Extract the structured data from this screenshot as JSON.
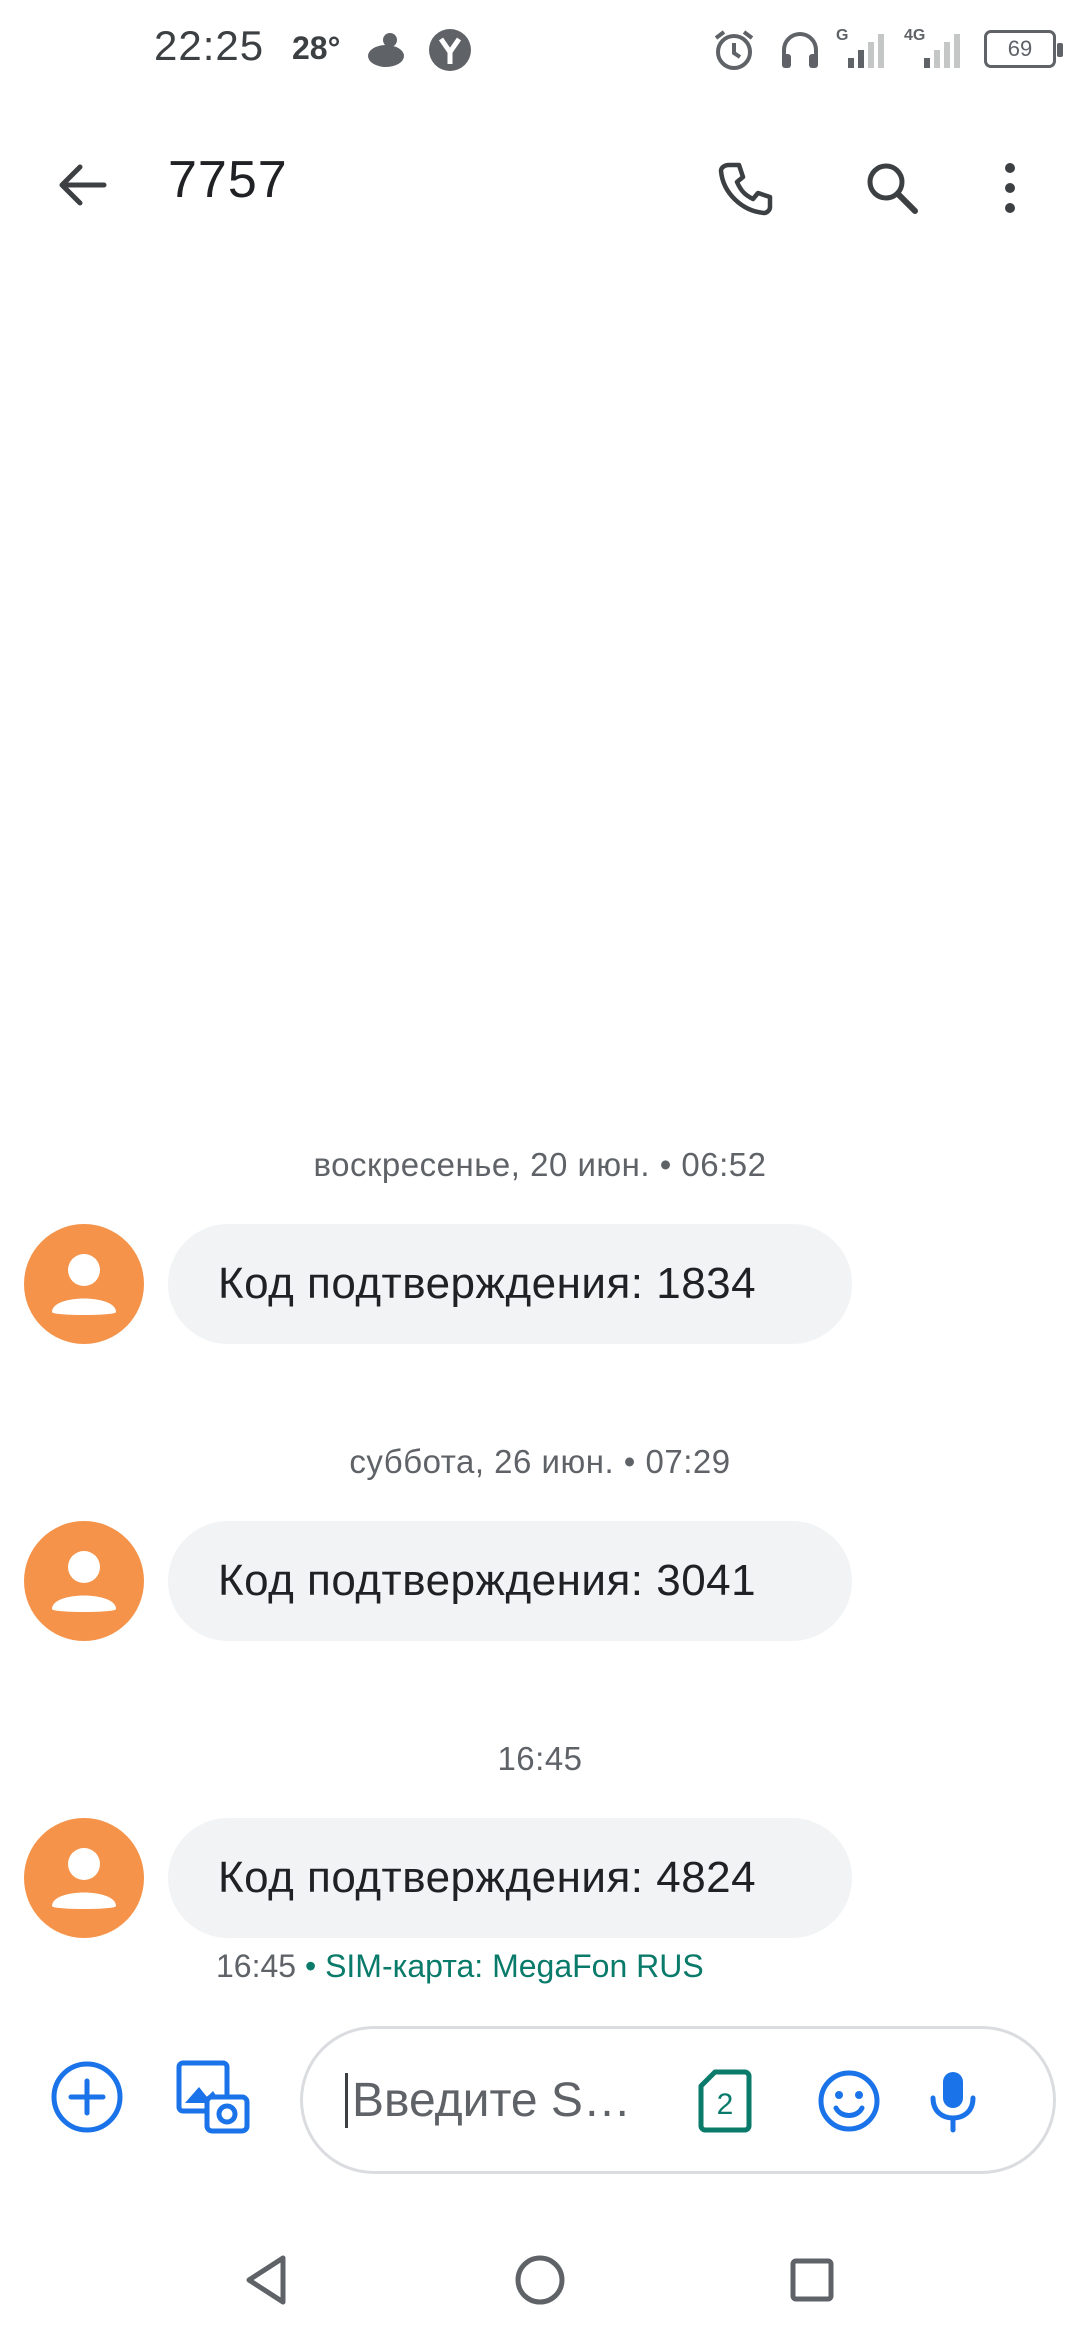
{
  "status_bar": {
    "time": "22:25",
    "temperature": "28°",
    "battery": "69",
    "network_labels": [
      "G",
      "4G"
    ]
  },
  "app_bar": {
    "title": "7757",
    "icons": [
      "back-arrow-icon",
      "phone-icon",
      "search-icon",
      "more-vert-icon"
    ]
  },
  "messages": [
    {
      "date": "воскресенье, 20 июн. • 06:52",
      "text": "Код подтверждения: 1834"
    },
    {
      "date": "суббота, 26 июн. • 07:29",
      "text": "Код подтверждения: 3041"
    },
    {
      "date": "16:45",
      "text": "Код подтверждения: 4824",
      "meta_time": "16:45",
      "meta_sim": " • SIM-карта: MegaFon RUS"
    }
  ],
  "compose": {
    "placeholder": "Введите SMS...",
    "sim_number": "2",
    "icons": [
      "add-circle-icon",
      "gallery-camera-icon",
      "sim-card-icon",
      "emoji-icon",
      "microphone-icon"
    ]
  },
  "colors": {
    "accent": "#1a73e8",
    "avatar": "#f5934a",
    "bubble": "#f1f3f4",
    "sim_label": "#0a7a6a"
  }
}
